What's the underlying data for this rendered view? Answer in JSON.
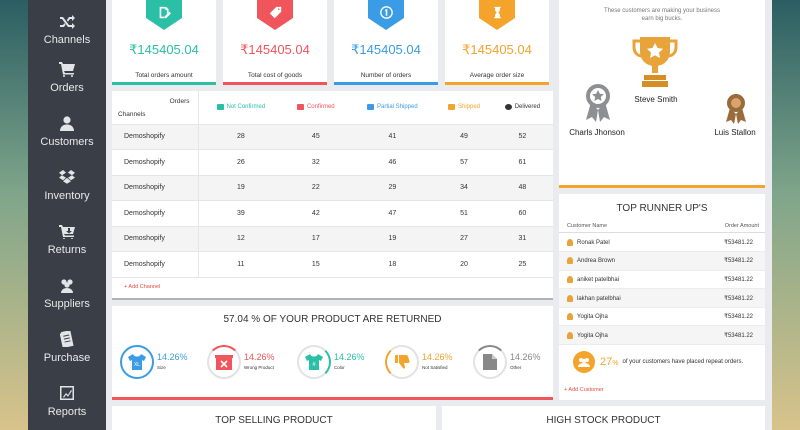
{
  "sidebar": {
    "items": [
      {
        "label": "Channels",
        "icon": "shuffle-icon"
      },
      {
        "label": "Orders",
        "icon": "cart-icon"
      },
      {
        "label": "Customers",
        "icon": "user-icon"
      },
      {
        "label": "Inventory",
        "icon": "dropbox-icon"
      },
      {
        "label": "Returns",
        "icon": "cart-return-icon"
      },
      {
        "label": "Suppliers",
        "icon": "users-icon"
      },
      {
        "label": "Purchase",
        "icon": "document-icon"
      },
      {
        "label": "Reports",
        "icon": "chart-icon"
      }
    ]
  },
  "stats": [
    {
      "value": "₹145405.04",
      "label": "Total orders amount",
      "color": "#2bbfa6",
      "icon": "edit-icon"
    },
    {
      "value": "₹145405.04",
      "label": "Total cost of goods",
      "color": "#f0555c",
      "icon": "tag-icon"
    },
    {
      "value": "₹145405.04",
      "label": "Number of orders",
      "color": "#3a9ce4",
      "icon": "coin-icon"
    },
    {
      "value": "₹145405.04",
      "label": "Average order size",
      "color": "#f4a32b",
      "icon": "hourglass-icon"
    }
  ],
  "orders_table": {
    "corner_top": "Orders",
    "corner_bottom": "Channels",
    "headers": [
      {
        "label": "Not Confirmed",
        "color": "#2bbfa6",
        "icon": "thumbs-down-icon"
      },
      {
        "label": "Confirmed",
        "color": "#f0555c",
        "icon": "thumbs-up-icon"
      },
      {
        "label": "Partial Shipped",
        "color": "#3a9ce4",
        "icon": "partial-shipped-icon"
      },
      {
        "label": "Shipped",
        "color": "#f4a32b",
        "icon": "truck-icon"
      },
      {
        "label": "Delivered",
        "color": "#333333",
        "icon": "check-circle-icon"
      }
    ],
    "rows": [
      {
        "channel": "Demoshopify",
        "values": [
          "28",
          "45",
          "41",
          "49",
          "52"
        ]
      },
      {
        "channel": "Demoshopify",
        "values": [
          "26",
          "32",
          "46",
          "57",
          "61"
        ]
      },
      {
        "channel": "Demoshopify",
        "values": [
          "19",
          "22",
          "29",
          "34",
          "48"
        ]
      },
      {
        "channel": "Demoshopify",
        "values": [
          "39",
          "42",
          "47",
          "51",
          "60"
        ]
      },
      {
        "channel": "Demoshopify",
        "values": [
          "12",
          "17",
          "19",
          "27",
          "31"
        ]
      },
      {
        "channel": "Demoshopify",
        "values": [
          "11",
          "15",
          "18",
          "20",
          "25"
        ]
      }
    ],
    "add_channel": "+ Add Channel"
  },
  "returns": {
    "title": "57.04 % OF YOUR PRODUCT ARE RETURNED",
    "items": [
      {
        "pct": "14.26%",
        "label": "Size",
        "color": "#3a9ce4",
        "icon": "shirt-xl-icon",
        "progress": 0.1426
      },
      {
        "pct": "14.26%",
        "label": "Wrong Product",
        "color": "#f0555c",
        "icon": "wrong-box-icon",
        "progress": 0.1426
      },
      {
        "pct": "14.26%",
        "label": "Color",
        "color": "#2bbfa6",
        "icon": "shirt-color-icon",
        "progress": 0.1426
      },
      {
        "pct": "14.26%",
        "label": "Not Satisfied",
        "color": "#f4a32b",
        "icon": "thumbs-down-icon",
        "progress": 0.1426
      },
      {
        "pct": "14.26%",
        "label": "Other",
        "color": "#888888",
        "icon": "file-icon",
        "progress": 0.1426
      }
    ]
  },
  "top_customers": {
    "subtitle_line1": "These customers are making your business",
    "subtitle_line2": "earn big bucks.",
    "first": "Steve Smith",
    "second": "Charls Jhonson",
    "third": "Luis Stallon"
  },
  "runner_ups": {
    "title": "TOP RUNNER UP'S",
    "col1": "Customer Name",
    "col2": "Order Amount",
    "rows": [
      {
        "name": "Ronak Patel",
        "amount": "₹53481.22"
      },
      {
        "name": "Andrea Brown",
        "amount": "₹53481.22"
      },
      {
        "name": "aniket patelbhai",
        "amount": "₹53481.22"
      },
      {
        "name": "lakhan patelbhai",
        "amount": "₹53481.22"
      },
      {
        "name": "Yogita Ojha",
        "amount": "₹53481.22"
      },
      {
        "name": "Yogita Ojha",
        "amount": "₹53481.22"
      }
    ],
    "repeat_pct": "27",
    "repeat_pct_sign": "%",
    "repeat_text": "of your customers have placed repeat orders.",
    "add_customer": "+ Add Customer"
  },
  "bottom": {
    "left_title": "TOP SELLING PRODUCT",
    "right_title": "HIGH STOCK PRODUCT"
  }
}
